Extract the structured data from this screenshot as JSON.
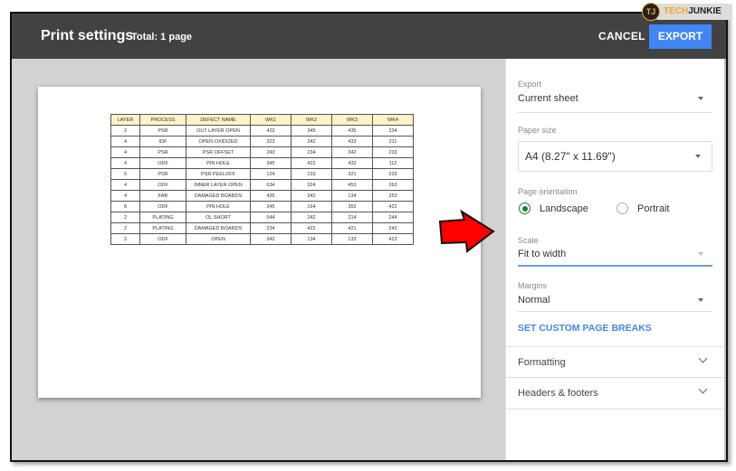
{
  "header": {
    "title": "Print settings",
    "total": "Total: 1 page",
    "cancel_label": "CANCEL",
    "export_label": "EXPORT"
  },
  "watermark": {
    "prefix": "TECH",
    "suffix": "JUNKIE",
    "icon_text": "TJ"
  },
  "preview": {
    "table": {
      "columns": [
        "LAYER",
        "PROCESS",
        "DEFECT NAME",
        "WK1",
        "WK2",
        "WK3",
        "WK4"
      ],
      "rows": [
        [
          "2",
          "PSR",
          "OUT LAYER OPEN",
          "432",
          "345",
          "435",
          "234"
        ],
        [
          "4",
          "IDF",
          "OPEN OXIDIZED",
          "323",
          "342",
          "433",
          "211"
        ],
        [
          "4",
          "PSR",
          "PSR OFFSET",
          "243",
          "234",
          "342",
          "233"
        ],
        [
          "4",
          "ODF",
          "PIN HOLE",
          "345",
          "422",
          "432",
          "112"
        ],
        [
          "6",
          "PSR",
          "PSR PEELOFF",
          "124",
          "133",
          "321",
          "233"
        ],
        [
          "4",
          "ODF",
          "INNER LAYER OPEN",
          "634",
          "324",
          "453",
          "263"
        ],
        [
          "4",
          "FAB",
          "DAMAGED BOARDS",
          "435",
          "342",
          "134",
          "253"
        ],
        [
          "8",
          "ODF",
          "PIN HOLE",
          "345",
          "164",
          "352",
          "422"
        ],
        [
          "2",
          "PLATING",
          "OL SHORT",
          "544",
          "242",
          "214",
          "244"
        ],
        [
          "2",
          "PLATING",
          "DAMAGED BOARDS",
          "234",
          "422",
          "421",
          "242"
        ],
        [
          "2",
          "ODF",
          "OPEN",
          "342",
          "134",
          "133",
          "423"
        ]
      ]
    }
  },
  "settings": {
    "export": {
      "label": "Export",
      "value": "Current sheet"
    },
    "paper_size": {
      "label": "Paper size",
      "value": "A4 (8.27\" x 11.69\")"
    },
    "orientation": {
      "label": "Page orientation",
      "options": [
        "Landscape",
        "Portrait"
      ],
      "selected": "Landscape"
    },
    "scale": {
      "label": "Scale",
      "value": "Fit to width"
    },
    "margins": {
      "label": "Margins",
      "value": "Normal"
    },
    "custom_breaks_label": "SET CUSTOM PAGE BREAKS",
    "sections": [
      "Formatting",
      "Headers & footers"
    ]
  },
  "colors": {
    "header_bg": "#424242",
    "accent": "#4285f4",
    "radio_on": "#188038",
    "table_header": "#fdf2c8",
    "annotation_arrow": "#ff0000"
  }
}
